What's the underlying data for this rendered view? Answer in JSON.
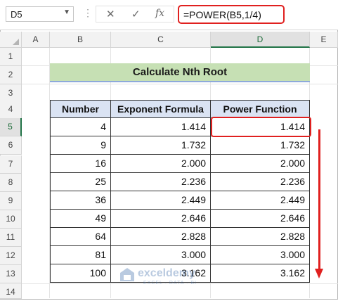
{
  "name_box": {
    "value": "D5"
  },
  "formula_bar": {
    "cancel_icon": "✕",
    "enter_icon": "✓",
    "fx_icon": "fx",
    "formula": "=POWER(B5,1/4)"
  },
  "columns": [
    "A",
    "B",
    "C",
    "D",
    "E"
  ],
  "rows": [
    "1",
    "2",
    "3",
    "4",
    "5",
    "6",
    "7",
    "8",
    "9",
    "10",
    "11",
    "12",
    "13",
    "14"
  ],
  "title": "Calculate Nth Root",
  "table": {
    "headers": [
      "Number",
      "Exponent Formula",
      "Power Function"
    ],
    "rows": [
      [
        "4",
        "1.414",
        "1.414"
      ],
      [
        "9",
        "1.732",
        "1.732"
      ],
      [
        "16",
        "2.000",
        "2.000"
      ],
      [
        "25",
        "2.236",
        "2.236"
      ],
      [
        "36",
        "2.449",
        "2.449"
      ],
      [
        "49",
        "2.646",
        "2.646"
      ],
      [
        "64",
        "2.828",
        "2.828"
      ],
      [
        "81",
        "3.000",
        "3.000"
      ],
      [
        "100",
        "3.162",
        "3.162"
      ]
    ]
  },
  "watermark": {
    "brand": "exceldemy",
    "tagline": "EXCEL · DATA · BI"
  },
  "colors": {
    "highlight": "#e0201f",
    "title_fill": "#c6e0b4",
    "header_fill": "#dae3f3",
    "excel_green": "#217346"
  }
}
